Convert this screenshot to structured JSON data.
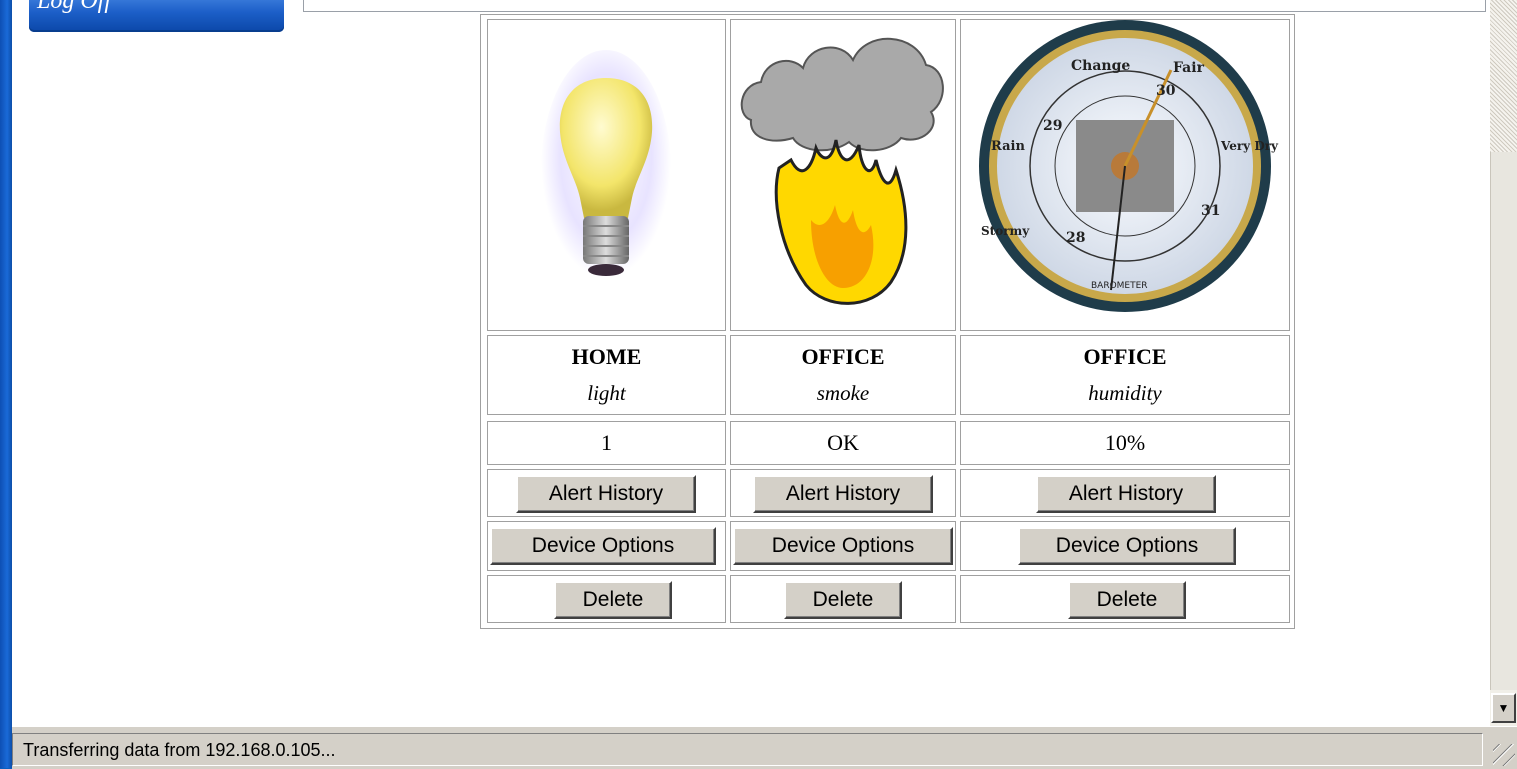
{
  "header": {
    "logoff_label": "Log Off"
  },
  "devices": [
    {
      "location": "HOME",
      "type": "light",
      "value": "1",
      "icon": "lightbulb-icon"
    },
    {
      "location": "OFFICE",
      "type": "smoke",
      "value": "OK",
      "icon": "smoke-fire-icon"
    },
    {
      "location": "OFFICE",
      "type": "humidity",
      "value": "10%",
      "icon": "barometer-icon"
    }
  ],
  "buttons": {
    "alert_history": "Alert History",
    "device_options": "Device Options",
    "delete": "Delete"
  },
  "barometer": {
    "top_label": "Change",
    "right_label": "Fair",
    "left_label": "Rain",
    "far_right": "Very Dry",
    "far_left": "Stormy",
    "bottom_label": "BAROMETER",
    "n30": "30",
    "n29": "29",
    "n28": "28",
    "n31": "31"
  },
  "status_bar": {
    "text": "Transferring data from 192.168.0.105..."
  },
  "colors": {
    "desktop_blue": "#0b5cc4",
    "button_face": "#d4d0c8"
  }
}
